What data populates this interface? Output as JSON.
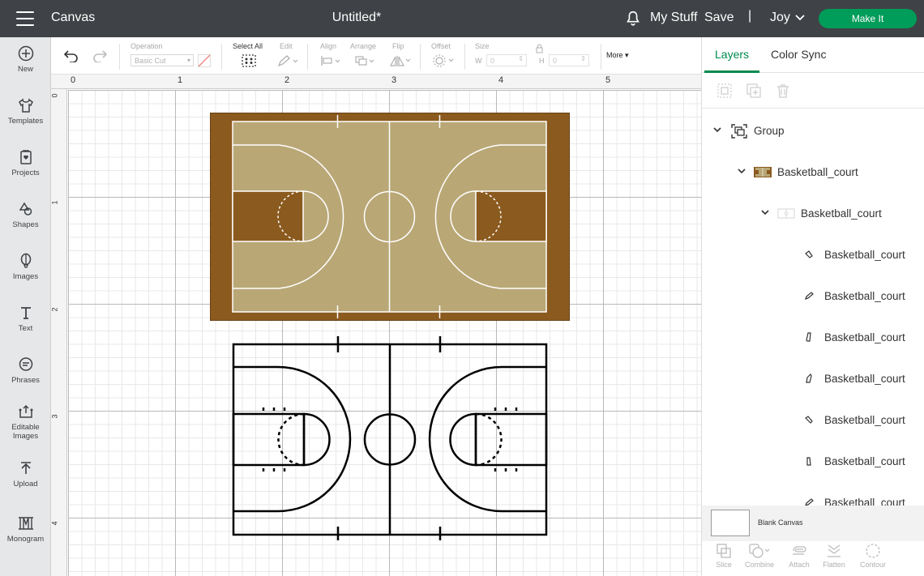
{
  "topbar": {
    "app_title": "Canvas",
    "doc_title": "Untitled*",
    "my_stuff": "My Stuff",
    "save": "Save",
    "separator": "|",
    "user": "Joy",
    "make_it": "Make It",
    "make_it_color": "#009c59"
  },
  "sidebar": {
    "new": "New",
    "templates": "Templates",
    "projects": "Projects",
    "shapes": "Shapes",
    "images": "Images",
    "text": "Text",
    "phrases": "Phrases",
    "editable_1": "Editable",
    "editable_2": "Images",
    "upload": "Upload",
    "monogram": "Monogram"
  },
  "toolbar": {
    "operation": "Operation",
    "operation_value": "Basic Cut",
    "select_all": "Select All",
    "edit": "Edit",
    "align": "Align",
    "arrange": "Arrange",
    "flip": "Flip",
    "offset": "Offset",
    "size": "Size",
    "w_label": "W",
    "w_value": "0",
    "h_label": "H",
    "h_value": "0",
    "more": "More"
  },
  "ruler": {
    "top": [
      "0",
      "1",
      "2",
      "3",
      "4",
      "5"
    ],
    "left": [
      "0",
      "1",
      "2",
      "3",
      "4"
    ]
  },
  "panel": {
    "tab_layers": "Layers",
    "tab_color_sync": "Color Sync",
    "layers": [
      {
        "name": "Group",
        "icon": "group-icon",
        "expanded": true
      },
      {
        "name": "Basketball_court",
        "icon": "court-color-thumb-icon",
        "expanded": true
      },
      {
        "name": "Basketball_court",
        "icon": "court-outline-thumb-icon",
        "expanded": true
      },
      {
        "name": "Basketball_court",
        "icon": "cut-path-icon"
      },
      {
        "name": "Basketball_court",
        "icon": "cut-path-icon"
      },
      {
        "name": "Basketball_court",
        "icon": "cut-path-icon"
      },
      {
        "name": "Basketball_court",
        "icon": "cut-path-icon"
      },
      {
        "name": "Basketball_court",
        "icon": "cut-path-icon"
      },
      {
        "name": "Basketball_court",
        "icon": "cut-path-icon"
      },
      {
        "name": "Basketball_court",
        "icon": "cut-path-icon"
      }
    ],
    "blank_canvas": "Blank Canvas",
    "slice": "Slice",
    "combine": "Combine",
    "attach": "Attach",
    "flatten": "Flatten",
    "contour": "Contour"
  },
  "colors": {
    "court_border": "#8b5a1e",
    "court_floor": "#b9a776",
    "accent": "#008a50"
  }
}
